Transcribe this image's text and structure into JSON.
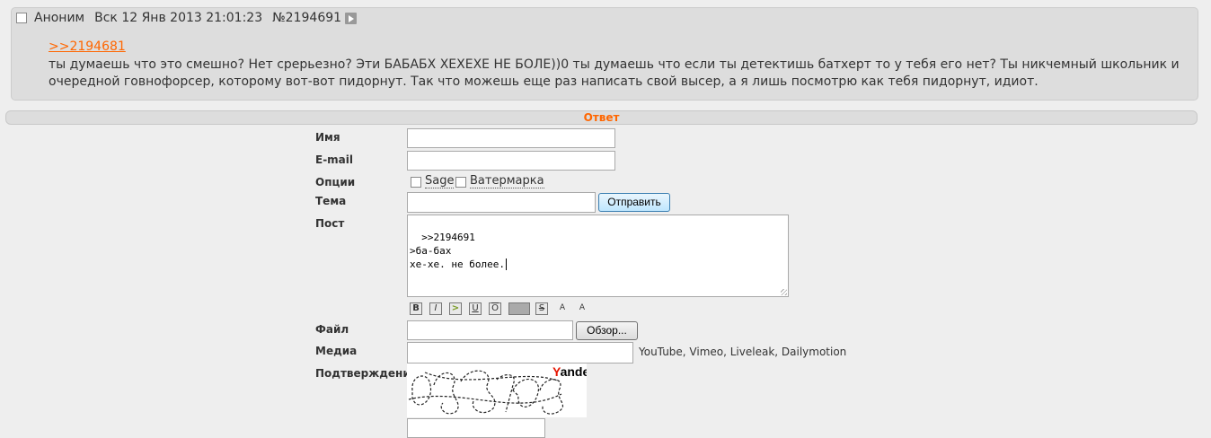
{
  "post": {
    "author": "Аноним",
    "date": "Вск 12 Янв 2013 21:01:23",
    "number": "№2194691",
    "reply_link": ">>2194681",
    "text": "ты думаешь что это смешно? Нет срерьезно? Эти БАБАБХ ХЕХЕХЕ НЕ БОЛЕ))0 ты думаешь что если ты детектишь батхерт то у тебя его нет? Ты никчемный школьник и очередной говнофорсер, которому вот-вот пидорнут. Так что можешь еще раз написать свой высер, а я лишь посмотрю как тебя пидорнут, идиот."
  },
  "reply_form": {
    "title": "Ответ",
    "labels": {
      "name": "Имя",
      "email": "E-mail",
      "options": "Опции",
      "subject": "Тема",
      "post": "Пост",
      "file": "Файл",
      "media": "Медиа",
      "captcha": "Подтверждение"
    },
    "name_value": "",
    "email_value": "",
    "options": {
      "sage_label": "Sage",
      "sage_checked": false,
      "watermark_label": "Ватермарка",
      "watermark_checked": false
    },
    "subject_value": "",
    "submit_label": "Отправить",
    "post_text": ">>2194691\n>ба-бах\nхе-хе. не более.",
    "format_buttons": [
      {
        "name": "bold",
        "glyph": "B"
      },
      {
        "name": "italic",
        "glyph": "I"
      },
      {
        "name": "quote",
        "glyph": ">"
      },
      {
        "name": "underline",
        "glyph": "U"
      },
      {
        "name": "overline",
        "glyph": "O"
      },
      {
        "name": "spoiler",
        "glyph": ""
      },
      {
        "name": "strikethrough",
        "glyph": "S"
      },
      {
        "name": "superscript",
        "glyph": "A"
      },
      {
        "name": "subscript",
        "glyph": "A"
      }
    ],
    "browse_label": "Обзор...",
    "media_hint": "YouTube, Vimeo, Liveleak, Dailymotion",
    "captcha": {
      "code": "095703",
      "brand": "Yandex",
      "answer": ""
    }
  },
  "colors": {
    "accent": "#ff6600",
    "page_bg": "#eeeeee",
    "post_bg": "#dddddd"
  }
}
